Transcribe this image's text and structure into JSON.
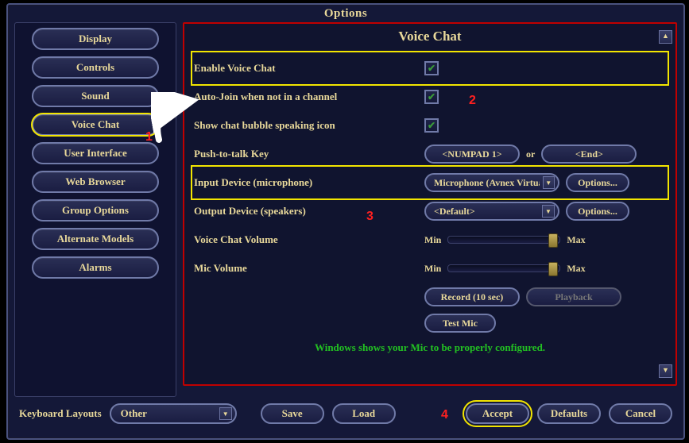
{
  "window": {
    "title": "Options"
  },
  "sidebar": {
    "items": [
      {
        "label": "Display"
      },
      {
        "label": "Controls"
      },
      {
        "label": "Sound"
      },
      {
        "label": "Voice Chat"
      },
      {
        "label": "User Interface"
      },
      {
        "label": "Web Browser"
      },
      {
        "label": "Group Options"
      },
      {
        "label": "Alternate Models"
      },
      {
        "label": "Alarms"
      }
    ],
    "selected_index": 3
  },
  "panel": {
    "title": "Voice Chat",
    "rows": {
      "enable": {
        "label": "Enable Voice Chat",
        "checked": true
      },
      "autojoin": {
        "label": "Auto-Join when not in a channel",
        "checked": true
      },
      "bubble": {
        "label": "Show chat bubble speaking icon",
        "checked": true
      },
      "ptt": {
        "label": "Push-to-talk Key",
        "primary": "<NUMPAD 1>",
        "or": "or",
        "secondary": "<End>"
      },
      "input": {
        "label": "Input Device (microphone)",
        "value": "Microphone (Avnex Virtua",
        "options_btn": "Options..."
      },
      "output": {
        "label": "Output Device (speakers)",
        "value": "<Default>",
        "options_btn": "Options..."
      },
      "vcvolume": {
        "label": "Voice Chat Volume",
        "min": "Min",
        "max": "Max",
        "pct": 90
      },
      "micvolume": {
        "label": "Mic Volume",
        "min": "Min",
        "max": "Max",
        "pct": 90
      },
      "record_btn": "Record (10 sec)",
      "playback_btn": "Playback",
      "testmic_btn": "Test Mic",
      "status": "Windows shows your Mic to be properly configured."
    }
  },
  "bottom": {
    "kb_label": "Keyboard Layouts",
    "kb_value": "Other",
    "save": "Save",
    "load": "Load",
    "accept": "Accept",
    "defaults": "Defaults",
    "cancel": "Cancel"
  },
  "annotations": {
    "n1": "1",
    "n2": "2",
    "n3": "3",
    "n4": "4"
  }
}
